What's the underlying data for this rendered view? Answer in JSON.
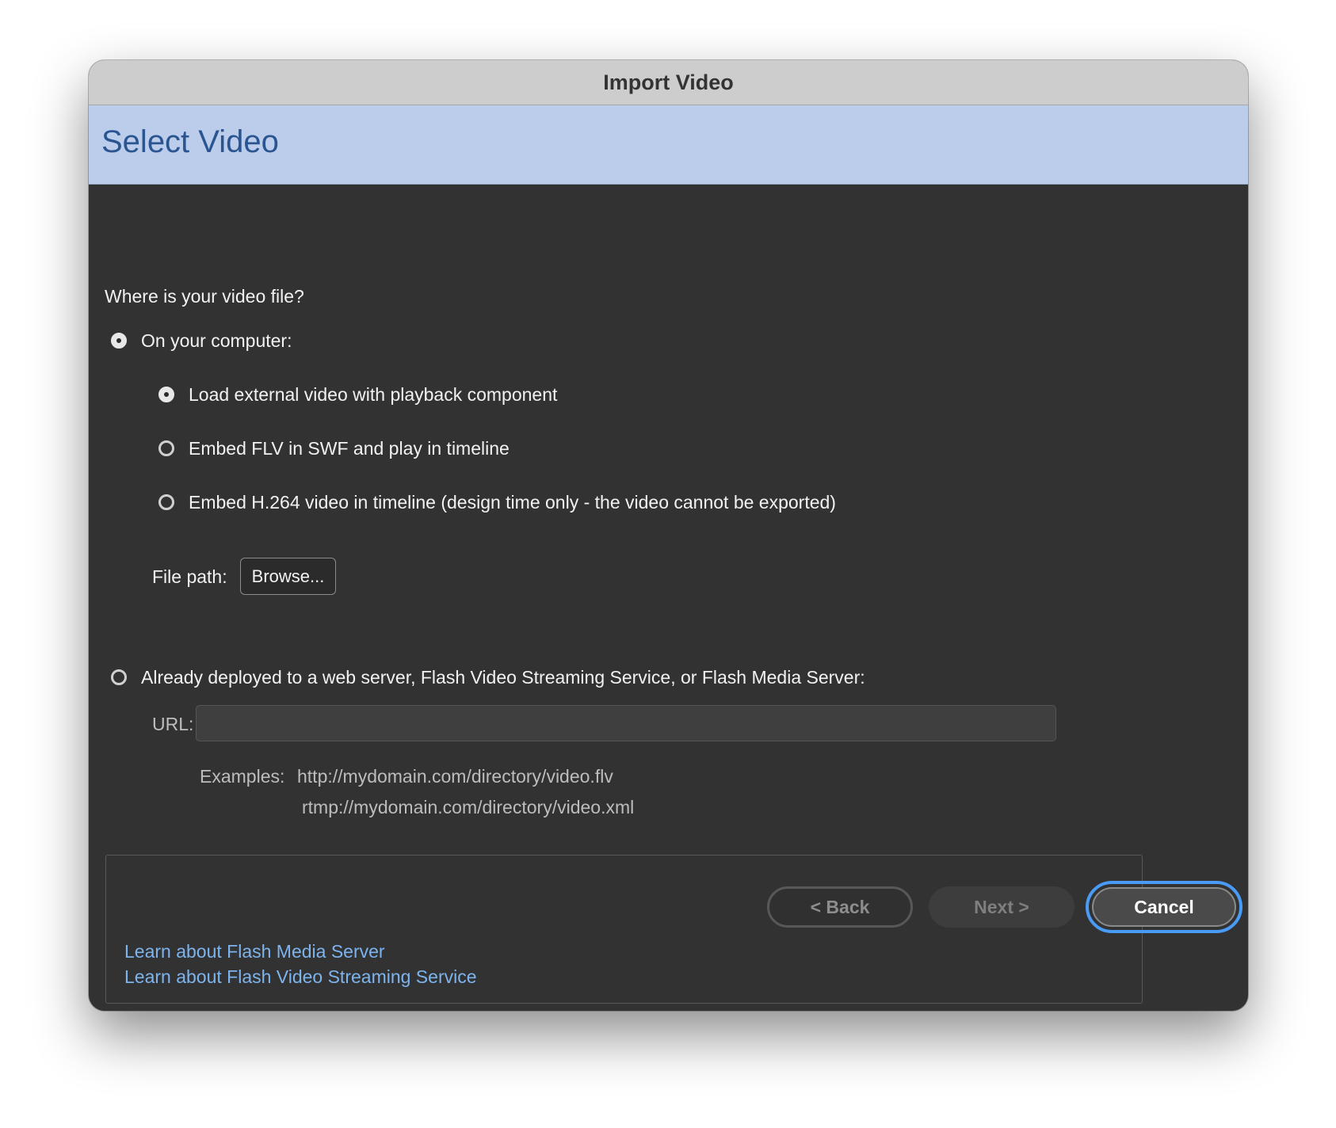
{
  "window": {
    "title": "Import Video"
  },
  "banner": {
    "title": "Select Video"
  },
  "form": {
    "question": "Where is your video file?",
    "computer_option": {
      "label": "On your computer:",
      "selected": true
    },
    "sub_options": [
      {
        "label": "Load external video with playback component",
        "selected": true
      },
      {
        "label": "Embed FLV in SWF and play in timeline",
        "selected": false
      },
      {
        "label": "Embed H.264 video in timeline (design time only - the video cannot be exported)",
        "selected": false
      }
    ],
    "file_path_label": "File path:",
    "browse_label": "Browse...",
    "server_option": {
      "label": "Already deployed to a web server, Flash Video Streaming Service, or Flash Media Server:",
      "selected": false
    },
    "url_label": "URL:",
    "url_value": "",
    "examples_label": "Examples:",
    "examples": [
      "http://mydomain.com/directory/video.flv",
      "rtmp://mydomain.com/directory/video.xml"
    ]
  },
  "help": {
    "links": [
      "Learn about Flash Media Server",
      "Learn about Flash Video Streaming Service"
    ]
  },
  "footer": {
    "back_label": "< Back",
    "next_label": "Next >",
    "cancel_label": "Cancel"
  },
  "colors": {
    "banner_bg": "#bccdec",
    "banner_text": "#2a5590",
    "content_bg": "#323232",
    "link": "#7db4ee",
    "focus_ring": "#4a9bf5"
  }
}
